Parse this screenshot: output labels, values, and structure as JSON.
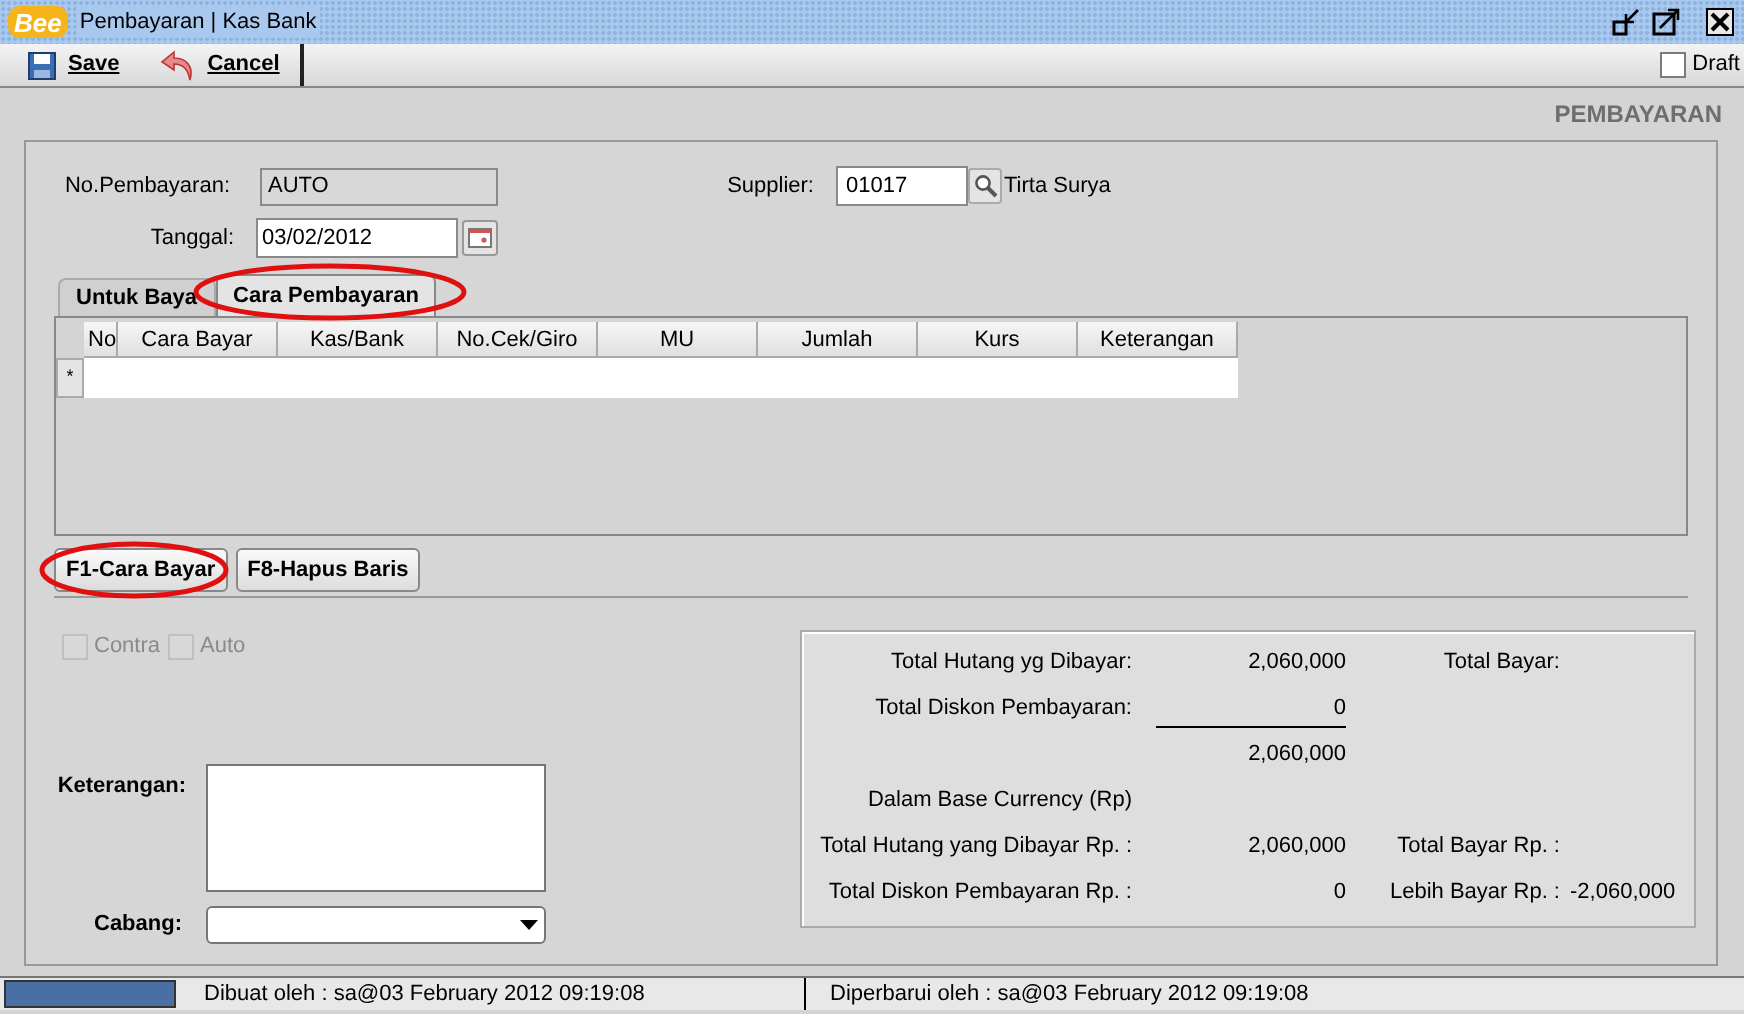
{
  "window": {
    "logo": "Bee",
    "title": "Pembayaran | Kas Bank"
  },
  "toolbar": {
    "buttons": [
      {
        "label": "Save",
        "kind": "save"
      },
      {
        "label": "Cancel",
        "kind": "cancel"
      }
    ],
    "draft": {
      "label": "Draft",
      "checked": false
    }
  },
  "form_title": "PEMBAYARAN",
  "fields": {
    "no_pembayaran": {
      "label": "No.Pembayaran:",
      "value": "AUTO"
    },
    "tanggal": {
      "label": "Tanggal:",
      "value": "03/02/2012"
    },
    "supplier": {
      "label": "Supplier:",
      "value": "01017",
      "name": "Tirta Surya"
    }
  },
  "tabs": [
    {
      "label": "Untuk Baya",
      "selected": false
    },
    {
      "label": "Cara Pembayaran",
      "selected": true
    }
  ],
  "table": {
    "columns": [
      "No",
      "Cara Bayar",
      "Kas/Bank",
      "No.Cek/Giro",
      "MU",
      "Jumlah",
      "Kurs",
      "Keterangan"
    ],
    "new_row_marker": "*"
  },
  "grid_buttons": [
    "F1-Cara Bayar",
    "F8-Hapus Baris"
  ],
  "options": [
    {
      "label": "Contra",
      "checked": false,
      "disabled": true
    },
    {
      "label": "Auto",
      "checked": false,
      "disabled": true
    }
  ],
  "keterangan": {
    "label": "Keterangan:"
  },
  "cabang": {
    "label": "Cabang:"
  },
  "summary": {
    "rows": [
      {
        "label": "Total Hutang yg Dibayar:",
        "value": "2,060,000",
        "right_label": "Total Bayar:"
      },
      {
        "label": "Total Diskon Pembayaran:",
        "value": "0",
        "underline": true
      },
      {
        "value": "2,060,000"
      },
      {
        "label": "Dalam Base Currency (Rp)"
      },
      {
        "label": "Total Hutang yang Dibayar Rp. :",
        "value": "2,060,000",
        "right_label": "Total Bayar Rp. :"
      },
      {
        "label": "Total Diskon Pembayaran Rp. :",
        "value": "0",
        "right_label": "Lebih Bayar Rp. :",
        "right_value": "-2,060,000"
      }
    ]
  },
  "status_bar": {
    "created": "Dibuat oleh : sa@03 February 2012  09:19:08",
    "updated": "Diperbarui oleh : sa@03 February 2012  09:19:08"
  }
}
